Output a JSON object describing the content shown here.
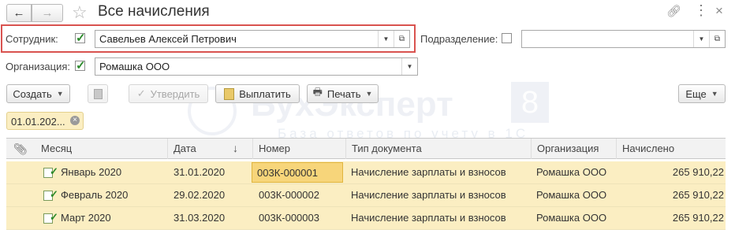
{
  "window": {
    "title": "Все начисления"
  },
  "filters": {
    "employee_label": "Сотрудник:",
    "employee_value": "Савельев Алексей Петрович",
    "division_label": "Подразделение:",
    "division_value": "",
    "organization_label": "Организация:",
    "organization_value": "Ромашка ООО"
  },
  "toolbar": {
    "create": "Создать",
    "approve": "Утвердить",
    "pay": "Выплатить",
    "print": "Печать",
    "more": "Еще"
  },
  "filter_chip": {
    "label": "01.01.202..."
  },
  "watermark": {
    "brand": "БухЭксперт",
    "number": "8",
    "subtitle": "База ответов по учету в 1С"
  },
  "table": {
    "columns": [
      "Месяц",
      "Дата",
      "Номер",
      "Тип документа",
      "Организация",
      "Начислено"
    ],
    "sort_indicator": "↓",
    "rows": [
      {
        "month": "Январь 2020",
        "date": "31.01.2020",
        "number": "003К-000001",
        "doc_type": "Начисление зарплаты и взносов",
        "org": "Ромашка ООО",
        "amount": "265 910,22"
      },
      {
        "month": "Февраль 2020",
        "date": "29.02.2020",
        "number": "003К-000002",
        "doc_type": "Начисление зарплаты и взносов",
        "org": "Ромашка ООО",
        "amount": "265 910,22"
      },
      {
        "month": "Март 2020",
        "date": "31.03.2020",
        "number": "003К-000003",
        "doc_type": "Начисление зарплаты и взносов",
        "org": "Ромашка ООО",
        "amount": "265 910,22"
      }
    ]
  },
  "colors": {
    "highlight_border": "#d9534f",
    "row_bg": "#fbeec2",
    "selected_cell": "#f7d57a",
    "check": "#2b8a2b"
  }
}
